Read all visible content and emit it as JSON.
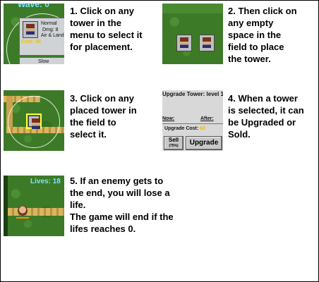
{
  "steps": [
    {
      "lines": [
        "1. Click on any",
        "tower in the",
        "menu to select it",
        "for placement."
      ]
    },
    {
      "lines": [
        "2. Then click on",
        "any empty",
        "space in the",
        "field to place",
        "the tower."
      ]
    },
    {
      "lines": [
        "3. Click on any",
        "placed tower in",
        "the field to",
        "select it."
      ]
    },
    {
      "lines": [
        "4. When a tower",
        "is selected, it can",
        "be Upgraded or",
        "Sold."
      ]
    },
    {
      "lines": [
        "5. If an enemy gets to",
        "the end, you will lose a",
        "life.",
        "The game will end if the",
        "lifes reaches 0."
      ]
    }
  ],
  "thumb1": {
    "wave_label": "Wave: 0",
    "tower_name": "Normal",
    "tower_dmg": "Dmg: 8",
    "tower_target": "Air & Land",
    "tower_cost": "Cost: 40",
    "next_tower": "Slow"
  },
  "thumb4": {
    "title": "Upgrade Tower: level 1",
    "now_label": "Now:",
    "after_label": "After:",
    "cost_label": "Upgrade Cost:",
    "cost_value": "60",
    "sell_label": "Sell",
    "sell_pct": "(75%)",
    "upgrade_label": "Upgrade"
  },
  "thumb5": {
    "lives_label": "Lives: 18"
  },
  "colors": {
    "grass": "#3d7a28",
    "path": "#c9a24a",
    "panel": "#d8d8d8",
    "hud_text": "#7fe3ff",
    "cost_text": "#f0c000"
  }
}
